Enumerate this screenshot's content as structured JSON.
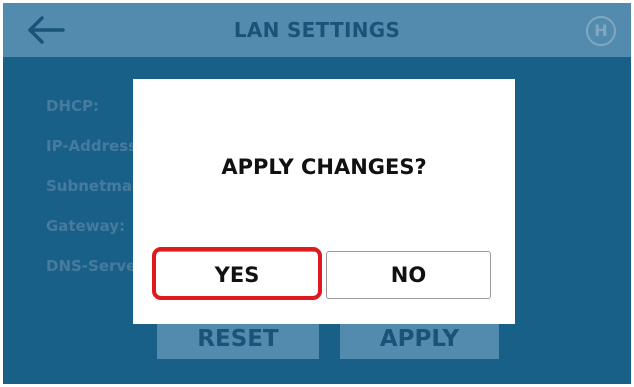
{
  "header": {
    "title": "LAN SETTINGS",
    "help_label": "H"
  },
  "form": {
    "labels": [
      "DHCP:",
      "IP-Address",
      "Subnetmas",
      "Gateway:",
      "DNS-Serve"
    ]
  },
  "buttons": {
    "reset_label": "RESET",
    "apply_label": "APPLY"
  },
  "dialog": {
    "title": "APPLY CHANGES?",
    "yes_label": "YES",
    "no_label": "NO"
  },
  "colors": {
    "background": "#1e6f9c",
    "header": "#6aa8cc",
    "title_text": "#1d5f88",
    "highlight": "#e0191f"
  },
  "icons": {
    "back": "back-arrow-icon",
    "help": "help-icon"
  }
}
